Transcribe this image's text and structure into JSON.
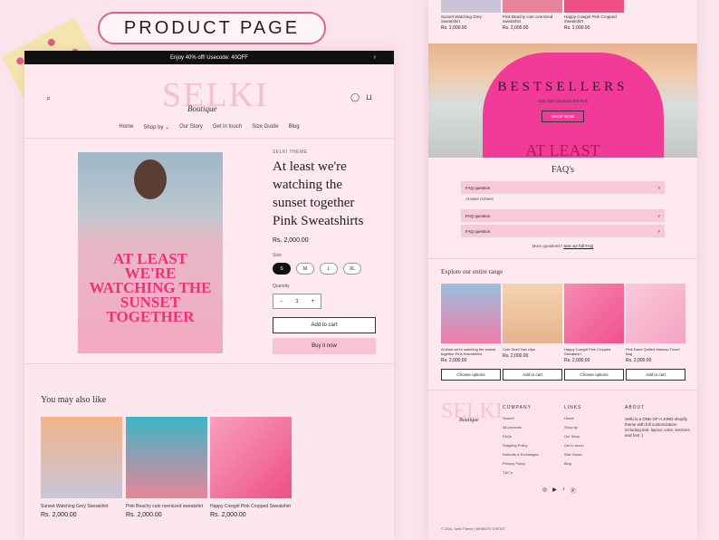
{
  "banner": {
    "title": "PRODUCT PAGE"
  },
  "store": {
    "announcement": "Enjoy 40% off! Usecode: 40OFF",
    "logo": "SELKI",
    "logo_script": "Boutique",
    "nav": [
      "Home",
      "Shop by",
      "Our Story",
      "Get in touch",
      "Size Guide",
      "Blog"
    ],
    "icons": [
      "search-icon",
      "account-icon",
      "cart-icon"
    ]
  },
  "product": {
    "vendor": "SELKI THEME",
    "title": "At least we're watching the sunset together Pink Sweatshirts",
    "hoodie_print": "AT LEAST WE'RE WATCHING THE SUNSET TOGETHER",
    "price": "Rs. 2,000.00",
    "size_label": "Size",
    "sizes": [
      "S",
      "M",
      "L",
      "XL"
    ],
    "selected_size": "S",
    "quantity_label": "Quantity",
    "quantity": "1",
    "add_to_cart": "Add to cart",
    "buy_now": "Buy it now"
  },
  "also_like": {
    "heading": "You may also like",
    "items": [
      {
        "title": "Sunset Watching Grey Sweatshirt",
        "price": "Rs. 2,000.00",
        "color": "#c9c5d8"
      },
      {
        "title": "Pink Beachy cute oversized sweatshirt",
        "price": "Rs. 2,000.00",
        "color": "#e8849a"
      },
      {
        "title": "Happy Cowgirl Pink Cropped Sweatshirt",
        "price": "Rs. 2,000.00",
        "color": "#ee4f85"
      }
    ]
  },
  "right": {
    "top_items": [
      {
        "title": "Sunset Watching Grey Sweatshirt",
        "price": "Rs. 2,000.00"
      },
      {
        "title": "Pink Beachy cute oversized sweatshirt",
        "price": "Rs. 2,000.00"
      },
      {
        "title": "Happy Cowgirl Pink Cropped Sweatshirt",
        "price": "Rs. 2,000.00"
      }
    ],
    "hero": {
      "title": "BESTSELLERS",
      "subtitle": "Only finer products left Pink",
      "button": "SHOP NOW",
      "print": "AT LEAST"
    },
    "faq": {
      "heading": "FAQ's",
      "questions": [
        "FAQ question",
        "FAQ question",
        "FAQ question"
      ],
      "answer": "Answer richtext",
      "more_text": "More questions?",
      "more_link": "See our full FAQ"
    },
    "explore": {
      "heading": "Explore our entire range",
      "items": [
        {
          "title": "At least we're watching the sunset together Pink Sweatshirts",
          "price": "Rs. 2,000.00",
          "button": "Choose options",
          "color": "#f07aa8"
        },
        {
          "title": "Cute Shell Hair clips",
          "price": "Rs. 2,000.00",
          "button": "Add to cart",
          "color": "#e6b38f"
        },
        {
          "title": "Happy Cowgirl Pink Cropped Sweatshirt",
          "price": "Rs. 2,000.00",
          "button": "Choose options",
          "color": "#f0508c"
        },
        {
          "title": "Pink Dand Quilted Makeup Travel Bag",
          "price": "Rs. 2,000.00",
          "button": "Add to cart",
          "color": "#f3a3c2"
        }
      ]
    },
    "footer": {
      "logo": "SELKI",
      "logo_script": "Boutique",
      "company_heading": "COMPANY",
      "company": [
        "Search",
        "All products",
        "FAQs",
        "Shipping Policy",
        "Refunds & Exchanges",
        "Privacy Policy",
        "T&C's"
      ],
      "links_heading": "LINKS",
      "links": [
        "Home",
        "Shop by",
        "Our Story",
        "Get in touch",
        "Size Guide",
        "Blog"
      ],
      "about_heading": "ABOUT",
      "about": "Selki is a ONE-OF-A-KIND shopify theme with full customization including text, layout, color, sections and font :)",
      "social": [
        "instagram-icon",
        "youtube-icon",
        "tiktok-icon",
        "pinterest-icon"
      ],
      "copyright": "© 2024, Selki Theme | WEBSITE CREDIT"
    }
  }
}
